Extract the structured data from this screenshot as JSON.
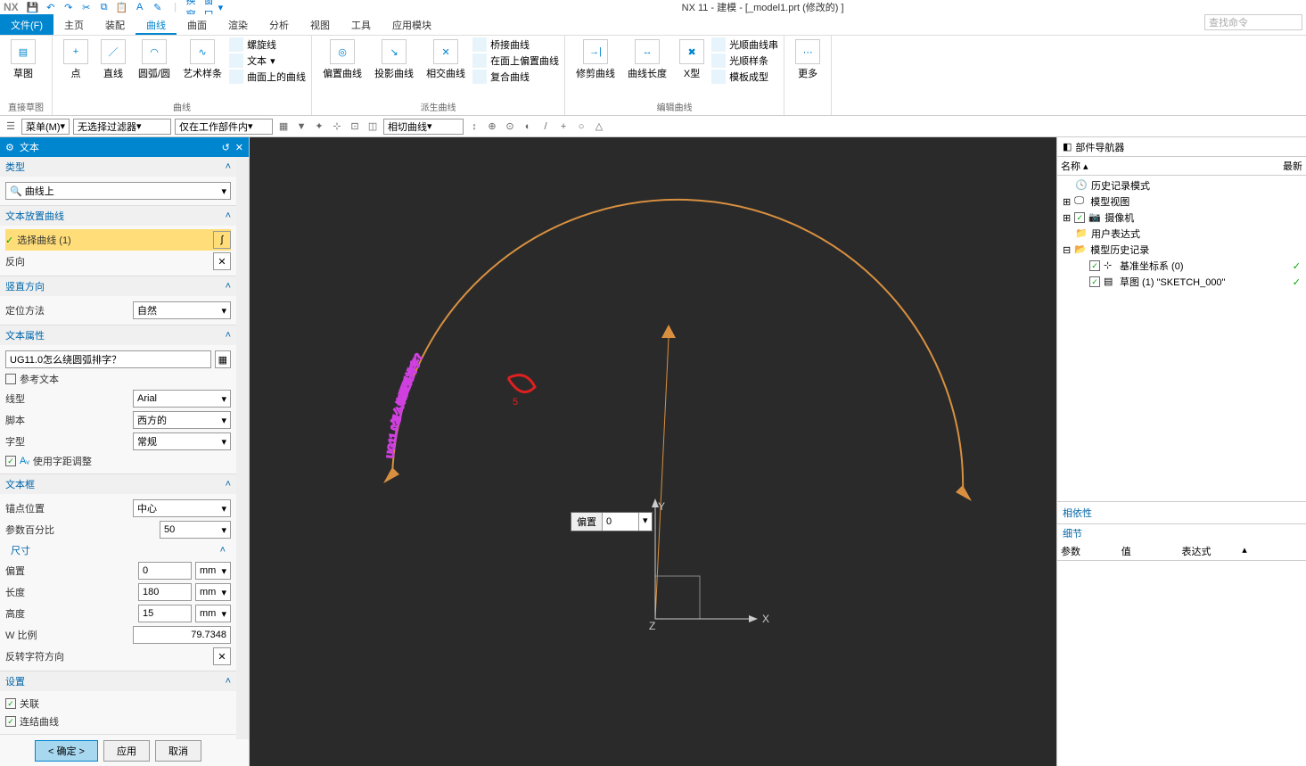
{
  "title": "NX 11 - 建模 - [_model1.prt (修改的) ]",
  "menubar": {
    "file": "文件(F)",
    "tabs": [
      "主页",
      "装配",
      "曲线",
      "曲面",
      "渲染",
      "分析",
      "视图",
      "工具",
      "应用模块"
    ],
    "active": 2,
    "searchPlaceholder": "查找命令"
  },
  "qat": {
    "switchWindow": "切换窗口",
    "window": "窗口"
  },
  "ribbon": {
    "g1": {
      "title": "直接草图",
      "sketch": "草图"
    },
    "g2": {
      "title": "曲线",
      "point": "点",
      "line": "直线",
      "arc": "圆弧/圆",
      "spline": "艺术样条",
      "helix": "螺旋线",
      "text": "文本",
      "curveonface": "曲面上的曲线"
    },
    "g3": {
      "title": "派生曲线",
      "offset": "偏置曲线",
      "project": "投影曲线",
      "intersect": "相交曲线",
      "bridge": "桥接曲线",
      "offsetface": "在面上偏置曲线",
      "composite": "复合曲线"
    },
    "g4": {
      "title": "编辑曲线",
      "trim": "修剪曲线",
      "length": "曲线长度",
      "xform": "X型",
      "smooth": "光顺曲线串",
      "smoothspline": "光顺样条",
      "template": "模板成型"
    },
    "g5": {
      "more": "更多"
    }
  },
  "toolbar": {
    "menu": "菜单(M)",
    "noFilter": "无选择过滤器",
    "workpart": "仅在工作部件内",
    "tangent": "相切曲线"
  },
  "panel": {
    "title": "文本",
    "type": {
      "h": "类型",
      "val": "曲线上"
    },
    "placement": {
      "h": "文本放置曲线",
      "select": "选择曲线 (1)",
      "reverse": "反向"
    },
    "vertical": {
      "h": "竖直方向",
      "method": "定位方法",
      "val": "自然"
    },
    "textprops": {
      "h": "文本属性",
      "text": "UG11.0怎么绕圆弧排字？",
      "ref": "参考文本",
      "linetype": "线型",
      "linetypeVal": "Arial",
      "script": "脚本",
      "scriptVal": "西方的",
      "style": "字型",
      "styleVal": "常规",
      "kerning": "使用字距调整"
    },
    "textbox": {
      "h": "文本框",
      "anchor": "锚点位置",
      "anchorVal": "中心",
      "percent": "参数百分比",
      "percentVal": "50",
      "size": "尺寸",
      "offset": "偏置",
      "offsetVal": "0",
      "length": "长度",
      "lengthVal": "180",
      "height": "高度",
      "heightVal": "15",
      "wratio": "W 比例",
      "wratioVal": "79.7348",
      "mm": "mm",
      "revchar": "反转字符方向"
    },
    "settings": {
      "h": "设置",
      "assoc": "关联",
      "joincurve": "连结曲线"
    },
    "buttons": {
      "ok": "确定",
      "apply": "应用",
      "cancel": "取消"
    }
  },
  "viewport": {
    "offsetLabel": "偏置",
    "offsetVal": "0",
    "curvedText": "UG11.0怎么绕圆弧排字？",
    "X": "X",
    "Y": "Y",
    "Z": "Z"
  },
  "nav": {
    "title": "部件导航器",
    "cols": {
      "name": "名称",
      "latest": "最新"
    },
    "history": "历史记录模式",
    "modelview": "模型视图",
    "camera": "摄像机",
    "userexpr": "用户表达式",
    "modelhistory": "模型历史记录",
    "datum": "基准坐标系 (0)",
    "sketch": "草图 (1) \"SKETCH_000\"",
    "dep": "相依性",
    "detail": "细节",
    "detcols": {
      "param": "参数",
      "value": "值",
      "expr": "表达式"
    }
  }
}
